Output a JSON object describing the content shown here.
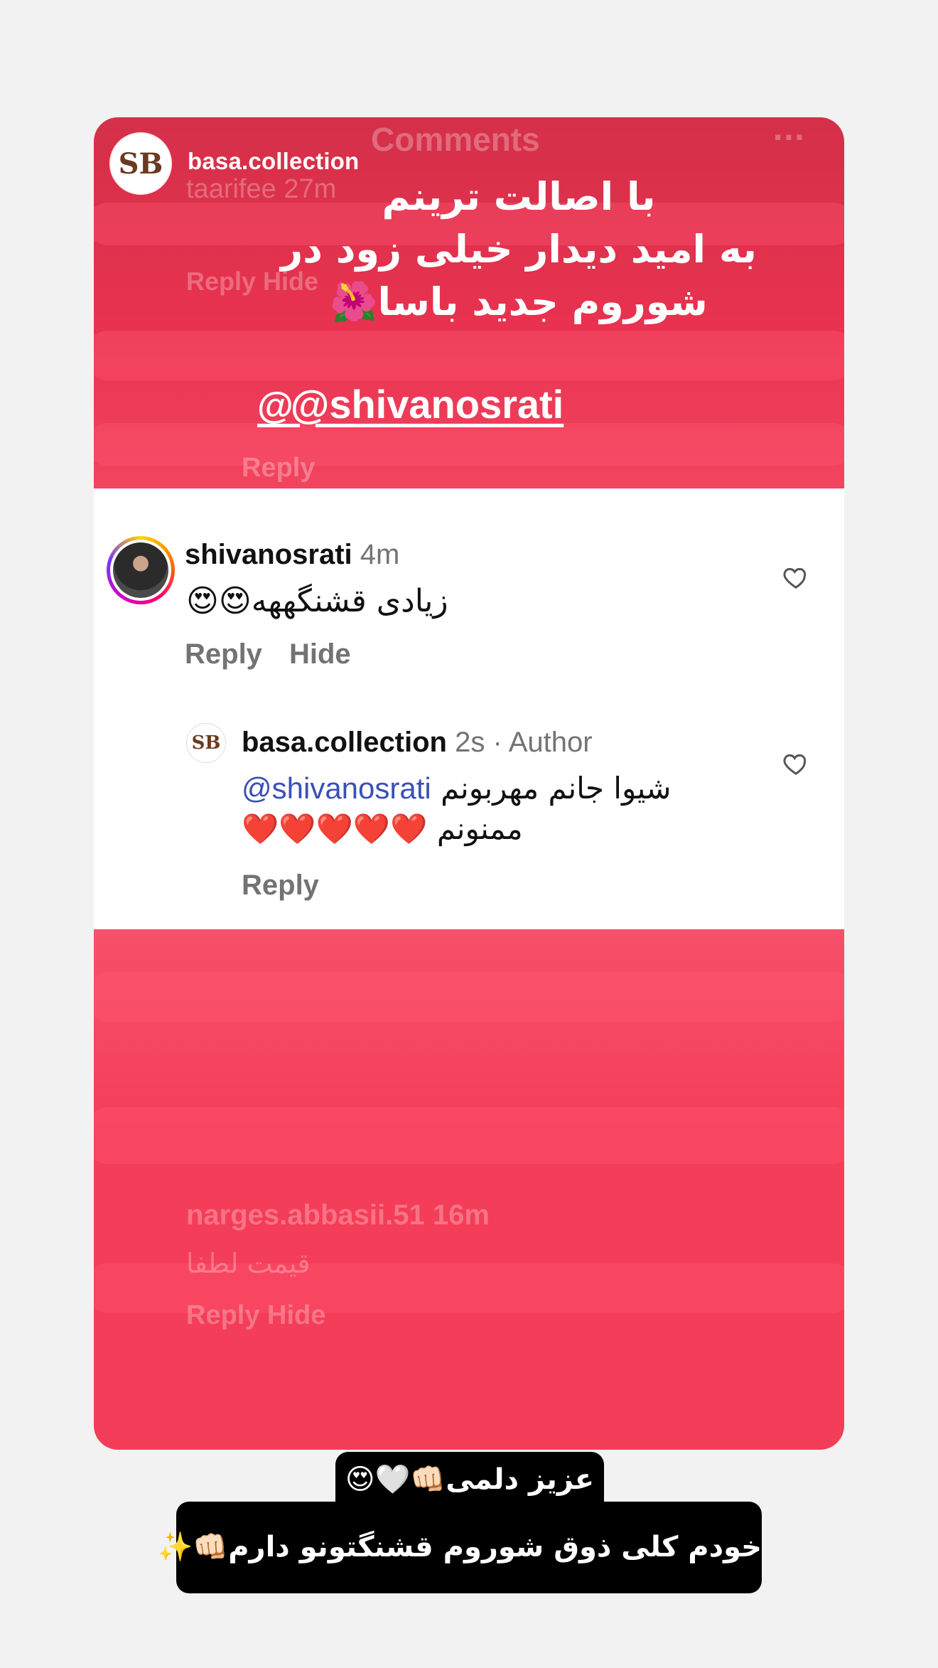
{
  "story": {
    "account_name": "basa.collection",
    "logo_text": "SB",
    "overlay_lines": [
      "با اصالت ترینم",
      "به امید دیدار خیلی زود در",
      "شوروم جدید باسا🌺"
    ],
    "mention": "@shivanosrati",
    "mention_icon": "threads-icon"
  },
  "background_ghosts": {
    "title": "Comments",
    "menu": "···",
    "user1": "taarifee 27m",
    "user1_actions": "Reply   Hide",
    "reply": "Reply",
    "user2": "narges.abbasii.51 16m",
    "user2_text": "قیمت لطفا",
    "user2_actions": "Reply   Hide"
  },
  "comments": [
    {
      "username": "shivanosrati",
      "time": "4m",
      "text": "زیادی قشنگههه😍😍",
      "actions": {
        "reply": "Reply",
        "hide": "Hide"
      }
    },
    {
      "username": "basa.collection",
      "time": "2s",
      "badge": "· Author",
      "mention": "@shivanosrati",
      "text_line1": "شیوا جانم مهربونم",
      "text_line2": "ممنونم ❤️❤️❤️❤️❤️",
      "actions": {
        "reply": "Reply"
      }
    }
  ],
  "captions": {
    "line1": "عزیز دلمی👊🏻🤍😍",
    "line2": "خودم کلی ذوق شوروم قشنگتونو دارم👊🏻✨"
  },
  "colors": {
    "highlight_red": "#f43d58",
    "background": "#f2f2f2",
    "mention_blue": "#3a4fb8",
    "meta_gray": "#737373"
  }
}
